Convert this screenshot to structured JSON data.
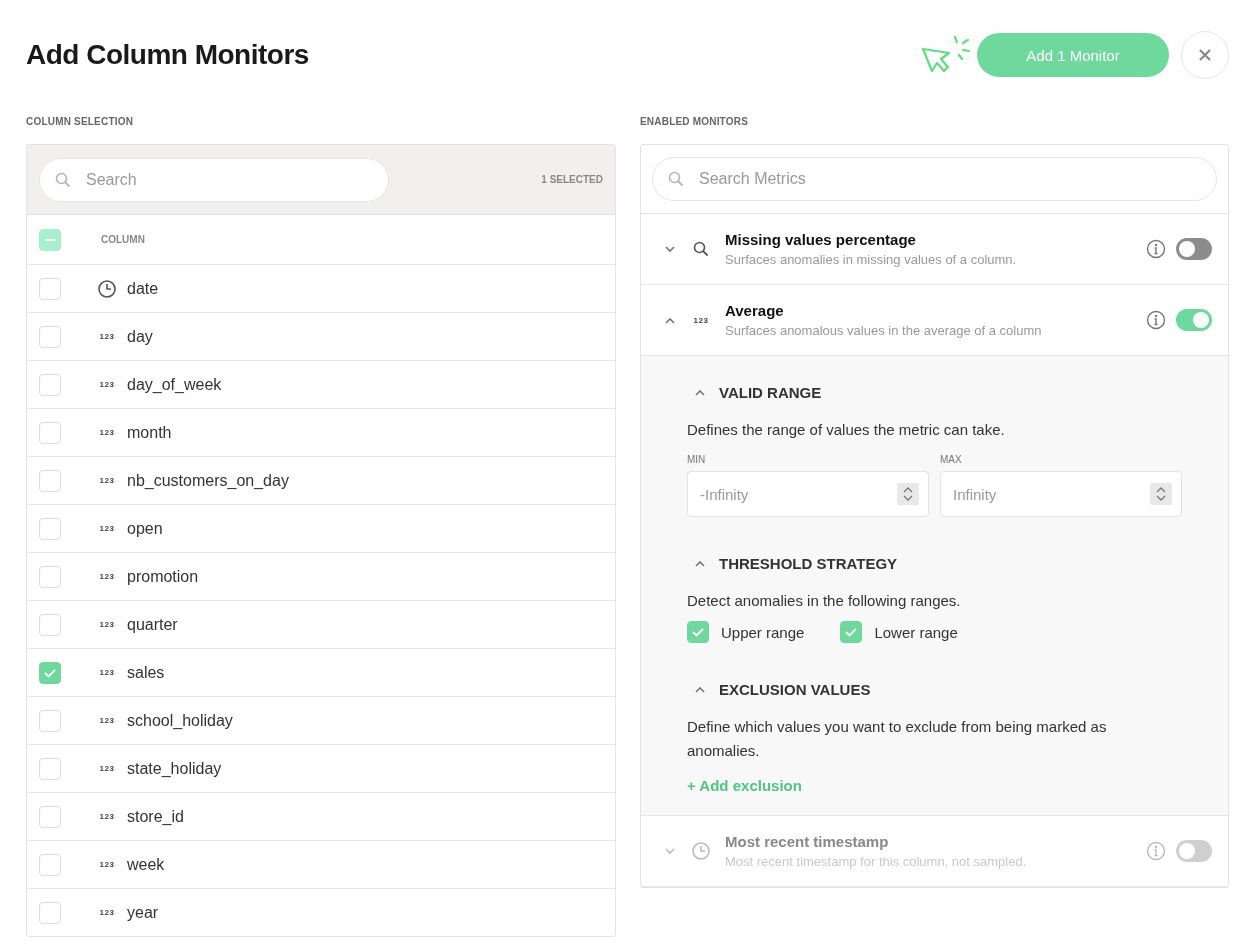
{
  "title": "Add Column Monitors",
  "primary_button": {
    "label": "Add 1 Monitor"
  },
  "column_selection": {
    "heading": "COLUMN SELECTION",
    "search": {
      "placeholder": "Search"
    },
    "selected_count": "1 SELECTED",
    "header": {
      "label": "COLUMN",
      "indeterminate": true
    },
    "columns": [
      {
        "name": "date",
        "kind": "time",
        "checked": false
      },
      {
        "name": "day",
        "kind": "number",
        "type_label": "123",
        "checked": false
      },
      {
        "name": "day_of_week",
        "kind": "number",
        "type_label": "123",
        "checked": false
      },
      {
        "name": "month",
        "kind": "number",
        "type_label": "123",
        "checked": false
      },
      {
        "name": "nb_customers_on_day",
        "kind": "number",
        "type_label": "123",
        "checked": false
      },
      {
        "name": "open",
        "kind": "number",
        "type_label": "123",
        "checked": false
      },
      {
        "name": "promotion",
        "kind": "number",
        "type_label": "123",
        "checked": false
      },
      {
        "name": "quarter",
        "kind": "number",
        "type_label": "123",
        "checked": false
      },
      {
        "name": "sales",
        "kind": "number",
        "type_label": "123",
        "checked": true
      },
      {
        "name": "school_holiday",
        "kind": "number",
        "type_label": "123",
        "checked": false
      },
      {
        "name": "state_holiday",
        "kind": "number",
        "type_label": "123",
        "checked": false
      },
      {
        "name": "store_id",
        "kind": "number",
        "type_label": "123",
        "checked": false
      },
      {
        "name": "week",
        "kind": "number",
        "type_label": "123",
        "checked": false
      },
      {
        "name": "year",
        "kind": "number",
        "type_label": "123",
        "checked": false
      }
    ]
  },
  "enabled_monitors": {
    "heading": "ENABLED MONITORS",
    "search": {
      "placeholder": "Search Metrics"
    },
    "monitors": [
      {
        "name": "Missing values percentage",
        "description": "Surfaces anomalies in missing values of a column.",
        "kind": "search",
        "expanded": false,
        "on": false,
        "disabled": false
      },
      {
        "name": "Average",
        "description": "Surfaces anomalous values in the average of a column",
        "kind": "number",
        "type_label": "123",
        "expanded": true,
        "on": true,
        "disabled": false,
        "sections": [
          {
            "kind": "range",
            "title": "VALID RANGE",
            "expanded": true,
            "description": "Defines the range of values the metric can take.",
            "fields": [
              {
                "label": "MIN",
                "placeholder": "-Infinity"
              },
              {
                "label": "MAX",
                "placeholder": "Infinity"
              }
            ]
          },
          {
            "kind": "checks",
            "title": "THRESHOLD STRATEGY",
            "expanded": true,
            "description": "Detect anomalies in the following ranges.",
            "options": [
              {
                "label": "Upper range",
                "checked": true
              },
              {
                "label": "Lower range",
                "checked": true
              }
            ]
          },
          {
            "kind": "link",
            "title": "EXCLUSION VALUES",
            "expanded": true,
            "description": "Define which values you want to exclude from being marked as anomalies.",
            "link": "+ Add exclusion"
          }
        ]
      },
      {
        "name": "Most recent timestamp",
        "description": "Most recent timestamp for this column, not sampled.",
        "kind": "time",
        "expanded": false,
        "on": false,
        "disabled": true
      }
    ]
  }
}
